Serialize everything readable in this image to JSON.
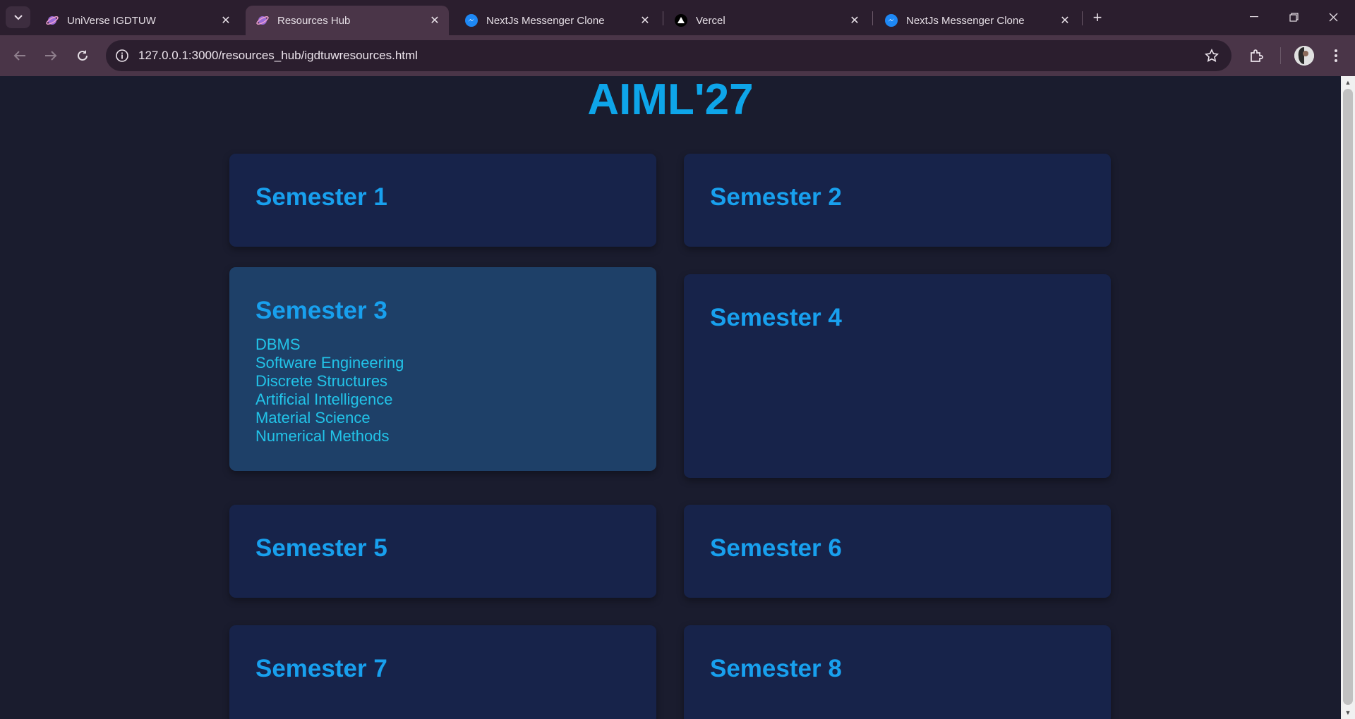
{
  "browser": {
    "tabs": [
      {
        "title": "UniVerse IGDTUW",
        "icon": "universe-favicon",
        "active": false
      },
      {
        "title": "Resources Hub",
        "icon": "universe-favicon",
        "active": true
      },
      {
        "title": "NextJs Messenger Clone",
        "icon": "messenger-favicon",
        "active": false
      },
      {
        "title": "Vercel",
        "icon": "vercel-favicon",
        "active": false
      },
      {
        "title": "NextJs Messenger Clone",
        "icon": "messenger-favicon",
        "active": false
      }
    ],
    "url": "127.0.0.1:3000/resources_hub/igdtuwresources.html",
    "accent_color": "#4a3548"
  },
  "page": {
    "title": "AIML'27",
    "title_color": "#0ea5e9",
    "semesters": [
      {
        "name": "Semester 1",
        "subjects": []
      },
      {
        "name": "Semester 2",
        "subjects": []
      },
      {
        "name": "Semester 3",
        "subjects": [
          "DBMS",
          "Software Engineering",
          "Discrete Structures",
          "Artificial Intelligence",
          "Material Science",
          "Numerical Methods"
        ],
        "expanded": true
      },
      {
        "name": "Semester 4",
        "subjects": []
      },
      {
        "name": "Semester 5",
        "subjects": []
      },
      {
        "name": "Semester 6",
        "subjects": []
      },
      {
        "name": "Semester 7",
        "subjects": []
      },
      {
        "name": "Semester 8",
        "subjects": []
      }
    ]
  }
}
